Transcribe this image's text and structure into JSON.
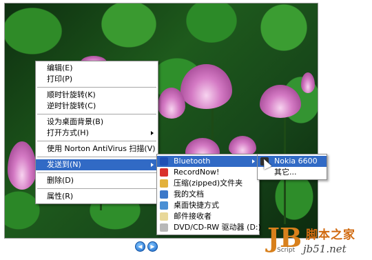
{
  "context_menu": {
    "items": [
      {
        "label": "编辑(E)",
        "type": "item"
      },
      {
        "label": "打印(P)",
        "type": "item"
      },
      {
        "type": "separator"
      },
      {
        "label": "顺时针旋转(K)",
        "type": "item"
      },
      {
        "label": "逆时针旋转(C)",
        "type": "item"
      },
      {
        "type": "separator"
      },
      {
        "label": "设为桌面背景(B)",
        "type": "item"
      },
      {
        "label": "打开方式(H)",
        "type": "submenu"
      },
      {
        "type": "separator"
      },
      {
        "label": "使用 Norton AntiVirus 扫描(V)",
        "type": "item"
      },
      {
        "type": "separator"
      },
      {
        "label": "发送到(N)",
        "type": "submenu",
        "selected": true
      },
      {
        "type": "separator"
      },
      {
        "label": "删除(D)",
        "type": "item"
      },
      {
        "type": "separator"
      },
      {
        "label": "属性(R)",
        "type": "item"
      }
    ]
  },
  "send_to_menu": {
    "items": [
      {
        "label": "Bluetooth",
        "icon": "bluetooth-icon",
        "color": "#1f4fb5",
        "submenu": true,
        "selected": true
      },
      {
        "label": "RecordNow!",
        "icon": "recordnow-icon",
        "color": "#d9302b"
      },
      {
        "label": "压缩(zipped)文件夹",
        "icon": "zip-folder-icon",
        "color": "#e3b13b"
      },
      {
        "label": "我的文档",
        "icon": "my-documents-icon",
        "color": "#3b78c9"
      },
      {
        "label": "桌面快捷方式",
        "icon": "desktop-shortcut-icon",
        "color": "#4a8fd4"
      },
      {
        "label": "邮件接收者",
        "icon": "mail-recipient-icon",
        "color": "#e8d89a"
      },
      {
        "label": "DVD/CD-RW 驱动器 (D:)",
        "icon": "cd-drive-icon",
        "color": "#b8b8b8"
      }
    ]
  },
  "bluetooth_menu": {
    "items": [
      {
        "label": "Nokia 6600",
        "icon": "phone-icon",
        "color": "#303030",
        "selected": true
      },
      {
        "label": "其它...",
        "icon": "",
        "color": ""
      }
    ]
  },
  "watermark": {
    "logo_letter": "JB",
    "logo_script": "Script",
    "site_name": "脚本之家",
    "site_url": "jb51.net"
  },
  "colors": {
    "selection": "#316ac5",
    "watermark_orange": "#d16a10"
  }
}
